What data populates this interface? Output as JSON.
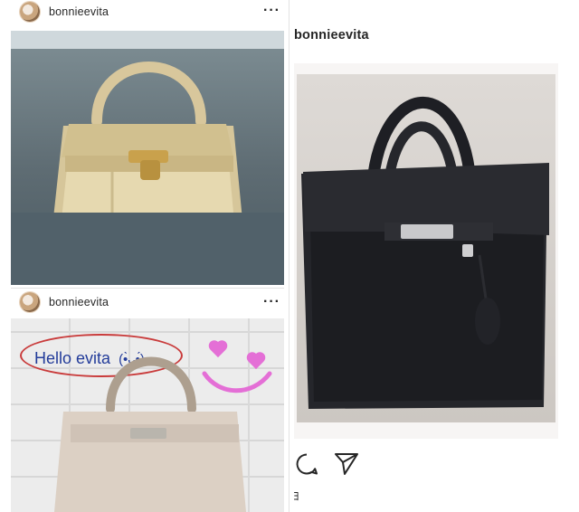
{
  "left_feed": {
    "post_top": {
      "username": "bonnieevita",
      "more": "···"
    },
    "post_bottom": {
      "username": "bonnieevita",
      "more": "···",
      "overlay_text": "Hello evita",
      "overlay_emoji": "(•̀ᴗ•́)"
    }
  },
  "right_post": {
    "username": "bonnieevita",
    "footer_mark": "ﾖ"
  },
  "colors": {
    "accent_red": "#c93b3b",
    "overlay_blue": "#233c9a",
    "heart_pink": "#e46fd6"
  },
  "icons": [
    "comment-icon",
    "share-icon",
    "more-icon"
  ]
}
